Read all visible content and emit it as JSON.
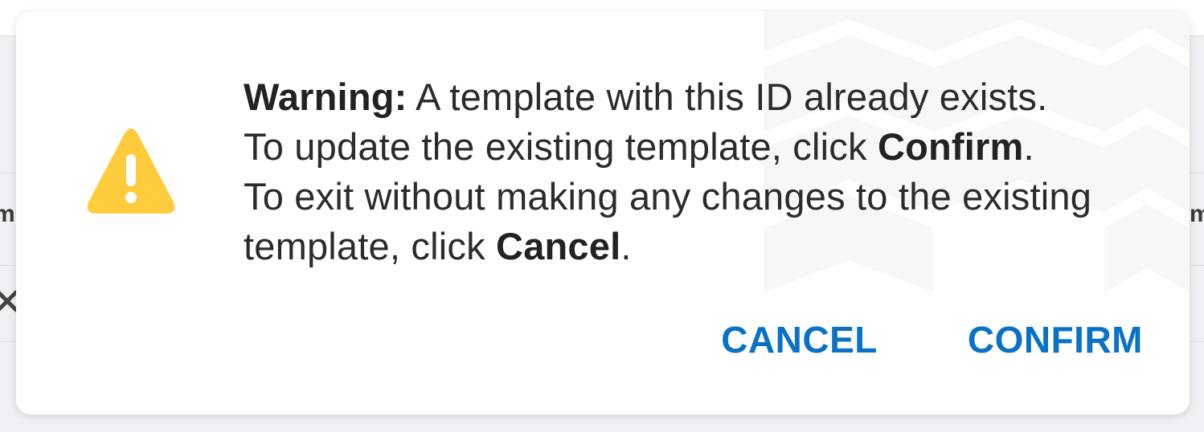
{
  "background": {
    "edge_left_text": "m",
    "edge_right_text": "m",
    "edge_left_icon": "close-icon"
  },
  "dialog": {
    "icon": "warning-triangle-icon",
    "icon_color": "#ffcc3d",
    "message": {
      "warning_label": "Warning:",
      "line1": "A template with this ID already exists.",
      "line2_prefix": "To update the existing template, click",
      "line2_bold": "Confirm",
      "line2_suffix": ".",
      "line3": "To exit without making any changes to the existing template, click",
      "line3_bold": "Cancel",
      "line3_suffix": "."
    },
    "buttons": {
      "cancel_label": "CANCEL",
      "confirm_label": "CONFIRM"
    },
    "accent_color": "#0a72c6"
  }
}
